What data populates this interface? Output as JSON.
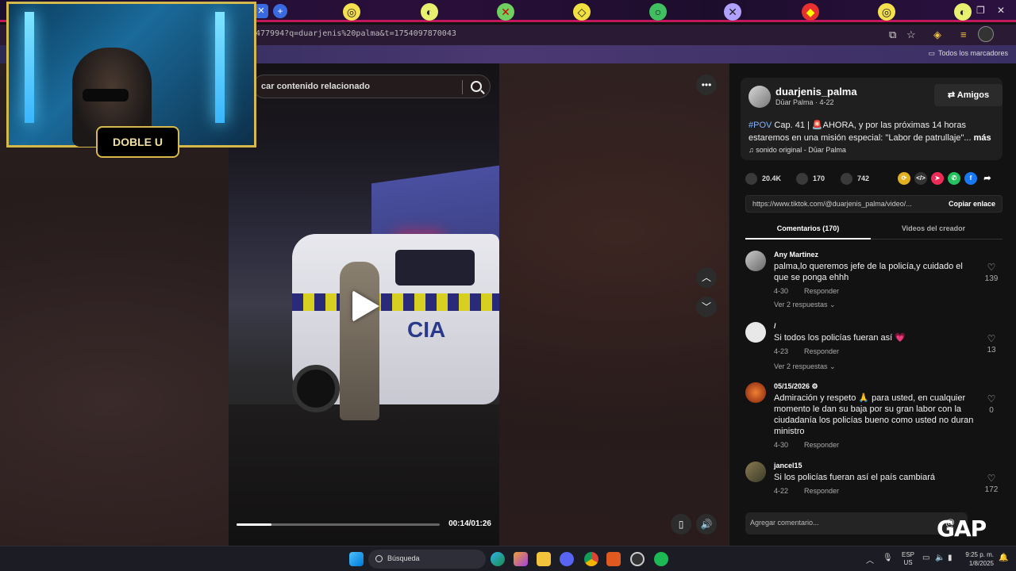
{
  "browser": {
    "url": "477994?q=duarjenis%20palma&t=1754097870043",
    "bookmarks_all": "Todos los marcadores"
  },
  "page": {
    "search_placeholder": "car contenido relacionado",
    "video": {
      "overlay_text": "CIA",
      "progress": 0.17,
      "timecode": "00:14/01:26"
    }
  },
  "panel": {
    "creator": {
      "username": "duarjenis_palma",
      "subtitle": "Dūar Palma · 4-22",
      "follow_label": "Amigos"
    },
    "description": {
      "hashtag": "#POV",
      "text": " Cap. 41 | 🚨AHORA, y por las próximas 14 horas estaremos en una misión especial: \"Labor de patrullaje\"...",
      "more": "más"
    },
    "sound": "sonido original - Dūar Palma",
    "stats": {
      "likes": "20.4K",
      "comments": "170",
      "saves": "742"
    },
    "link": {
      "url": "https://www.tiktok.com/@duarjenis_palma/video/...",
      "copy_label": "Copiar enlace"
    },
    "tabs": [
      "Comentarios (170)",
      "Videos del creador"
    ],
    "comments": [
      {
        "user": "Any Martinez",
        "text": "palma,lo queremos jefe de la policía,y cuidado el que se ponga ehhh",
        "date": "4-30",
        "reply": "Responder",
        "more": "Ver 2 respuestas ⌄",
        "likes": "139"
      },
      {
        "user": "/",
        "text": "Si todos los policías fueran así 💗",
        "date": "4-23",
        "reply": "Responder",
        "more": "Ver 2 respuestas ⌄",
        "likes": "13"
      },
      {
        "user": "05/15/2026 ⚙",
        "text": "Admiración y respeto 🙏 para usted, en cualquier momento le dan su baja por su gran labor con la ciudadanía los policías bueno como usted no duran ministro",
        "date": "4-30",
        "reply": "Responder",
        "likes": "0"
      },
      {
        "user": "jancel15",
        "text": "Si los policías fueran así el país cambiará",
        "date": "4-22",
        "reply": "Responder",
        "likes": "172"
      }
    ],
    "add_comment_placeholder": "Agregar comentario...",
    "watermark": "GAP"
  },
  "webcam": {
    "logo": "DOBLE U"
  },
  "taskbar": {
    "search": "Búsqueda",
    "lang_top": "ESP",
    "lang_bottom": "US",
    "time": "9:25 p. m.",
    "date": "1/8/2025"
  }
}
